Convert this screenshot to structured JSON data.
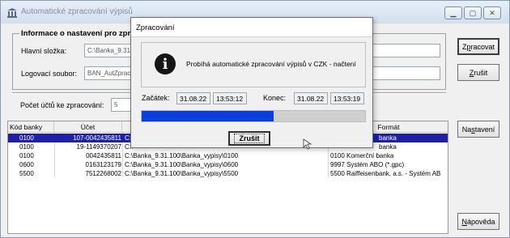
{
  "window": {
    "title": "Automatické zpracování výpisů",
    "controls": [
      "minimize",
      "maximize",
      "close"
    ]
  },
  "group": {
    "legend": "Informace o nastavení pro zpr",
    "main_folder_label": "Hlavní složka:",
    "main_folder_value": "C:\\Banka_9.31",
    "log_file_label": "Logovací soubor:",
    "log_file_value": "BAN_AutZpracV"
  },
  "accounts_count_label": "Počet účtů ke zpracování:",
  "accounts_count_value": "5",
  "buttons": {
    "process": {
      "pre": "Z",
      "u": "p",
      "post": "racovat"
    },
    "cancel": {
      "pre": "",
      "u": "Z",
      "post": "rušit"
    },
    "settings": {
      "pre": "Na",
      "u": "s",
      "post": "tavení"
    },
    "help": {
      "pre": "",
      "u": "N",
      "post": "ápověda"
    }
  },
  "table": {
    "columns": [
      "Kód banky",
      "Účet",
      "",
      "Formát"
    ],
    "rows": [
      {
        "code": "0100",
        "account": "107-0042435811",
        "path": "C:\\",
        "format": "banka",
        "selected": true
      },
      {
        "code": "0100",
        "account": "19-1149370207",
        "path": "C:\\",
        "format": "banka",
        "selected": false
      },
      {
        "code": "0100",
        "account": "0042435811",
        "path": "C:\\Banka_9.31.100\\Banka_vypisy\\0100",
        "format": "0100 Komerční banka",
        "selected": false
      },
      {
        "code": "0600",
        "account": "0163123179",
        "path": "C:\\Banka_9.31.100\\Banka_vypisy\\0600",
        "format": "9997 Systém ABO (*.gpc)",
        "selected": false
      },
      {
        "code": "5500",
        "account": "7512268002",
        "path": "C:\\Banka_9.31.100\\Banka_vypisy\\5500",
        "format": "5500 Raiffeisenbank, a.s. - Systém AB",
        "selected": false
      }
    ]
  },
  "dialog": {
    "title": "Zpracování",
    "message": "Probíhá automatické zpracování výpisů v CZK - načtení",
    "start_label": "Začátek:",
    "start_date": "31.08.22",
    "start_time": "13:53:12",
    "end_label": "Konec:",
    "end_date": "31.08.22",
    "end_time": "13:53:19",
    "progress_fraction": 0.59,
    "cancel_button": "Zrušit"
  },
  "colors": {
    "selection": "#1f1fa8",
    "progress": "#0b3fdc"
  }
}
